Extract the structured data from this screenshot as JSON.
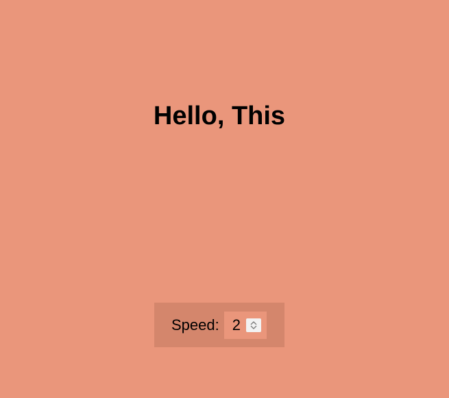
{
  "headline": "Hello, This",
  "speed": {
    "label": "Speed:",
    "value": "2"
  },
  "icons": {
    "spinner_up": "chevron-up-icon",
    "spinner_down": "chevron-down-icon"
  },
  "colors": {
    "background": "#EA967B",
    "controls_panel": "#D4866C",
    "spinner": "#F2F2F2"
  }
}
